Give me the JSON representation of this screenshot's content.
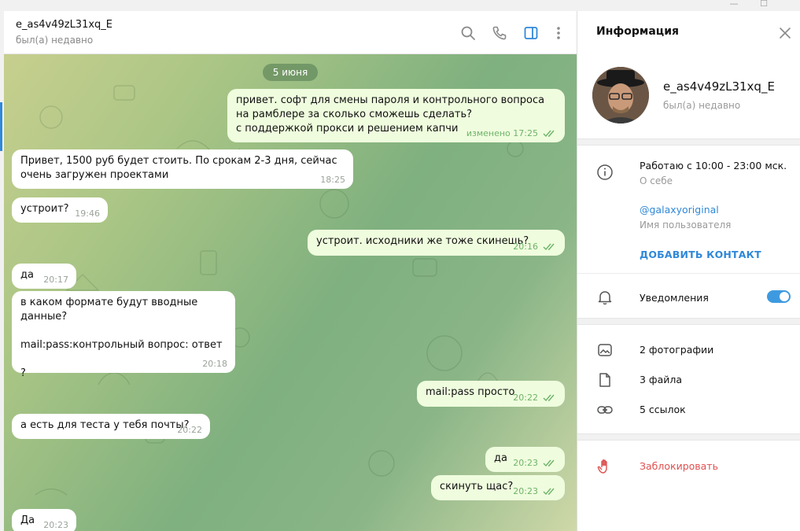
{
  "window": {
    "minimize_label": "—",
    "maximize_label": "☐"
  },
  "chat_header": {
    "peer_name": "e_as4v49zL31xq_E",
    "peer_status": "был(а) недавно",
    "icons": [
      "search-icon",
      "phone-icon",
      "sidebar-panel-icon",
      "more-vertical-icon"
    ],
    "active_icon_color": "#2f88d8"
  },
  "messages": {
    "date_label": "5 июня",
    "items": [
      {
        "dir": "out",
        "text": "привет. софт для смены пароля и контрольного вопроса на рамблере за сколько сможешь сделать?\nс поддержкой прокси и решением капчи",
        "time": "изменено 17:25",
        "read": true
      },
      {
        "dir": "in",
        "text": "Привет, 1500 руб будет стоить. По срокам 2-3 дня, сейчас очень загружен проектами",
        "time": "18:25"
      },
      {
        "dir": "in",
        "text": "устроит?",
        "time": "19:46"
      },
      {
        "dir": "out",
        "text": "устроит. исходники же тоже скинешь?",
        "time": "20:16",
        "read": true
      },
      {
        "dir": "in",
        "text": "да",
        "time": "20:17"
      },
      {
        "dir": "in",
        "text": "в каком формате будут вводные данные?\n\nmail:pass:контрольный вопрос: ответ\n\n?",
        "time": "20:18"
      },
      {
        "dir": "out",
        "text": "mail:pass просто",
        "time": "20:22",
        "read": true
      },
      {
        "dir": "in",
        "text": "а есть для теста у тебя почты?",
        "time": "20:22"
      },
      {
        "dir": "out",
        "text": "да",
        "time": "20:23",
        "read": true
      },
      {
        "dir": "out",
        "text": "скинуть щас?",
        "time": "20:23",
        "read": true
      },
      {
        "dir": "in",
        "text": "Да",
        "time": "20:23"
      }
    ]
  },
  "info_panel": {
    "title": "Информация",
    "name": "e_as4v49zL31xq_E",
    "status": "был(а) недавно",
    "about_text": "Работаю с 10:00 - 23:00 мск.",
    "about_label": "О себе",
    "username": "@galaxyoriginal",
    "username_label": "Имя пользователя",
    "add_contact": "ДОБАВИТЬ КОНТАКТ",
    "notifications_label": "Уведомления",
    "notifications_on": true,
    "photos": "2 фотографии",
    "files": "3 файла",
    "links": "5 ссылок",
    "block": "Заблокировать"
  },
  "colors": {
    "accent": "#2f88d8",
    "outgoing_bubble": "#effdde",
    "incoming_bubble": "#ffffff",
    "read_check": "#6fb36a",
    "danger": "#e05050"
  }
}
